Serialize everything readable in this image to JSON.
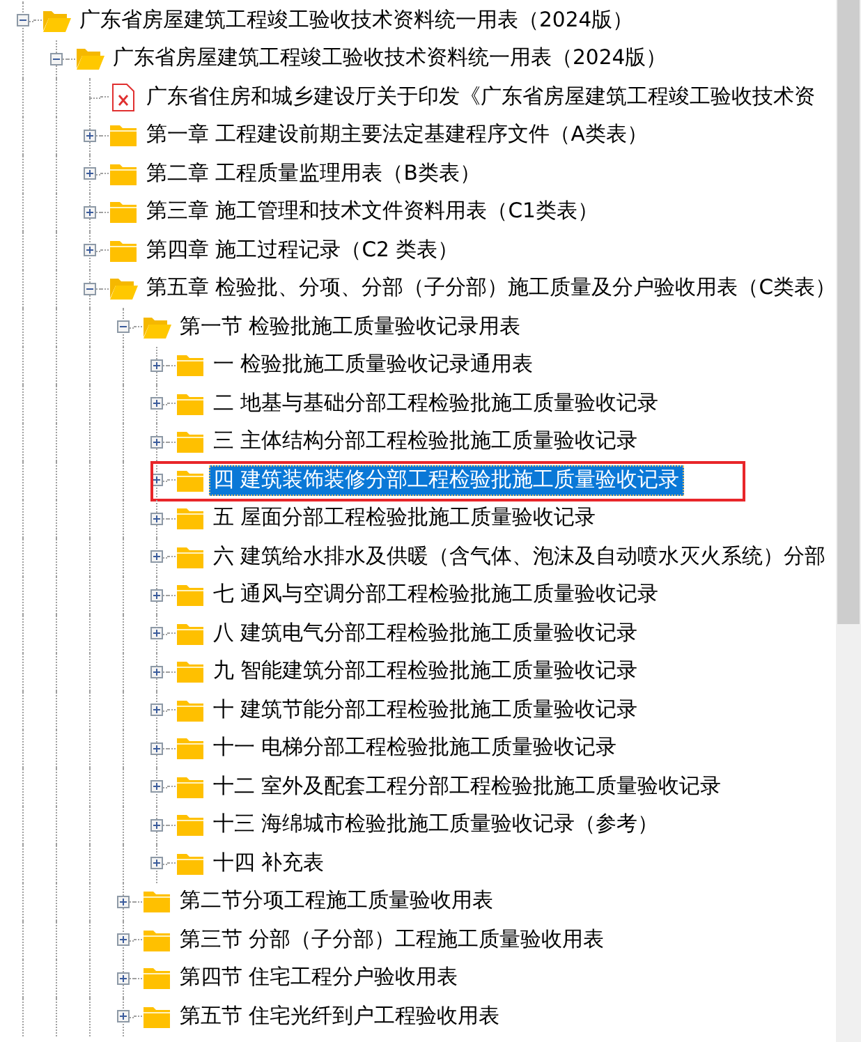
{
  "tree": [
    {
      "label": "广东省房屋建筑工程竣工验收技术资料统一用表（2024版）",
      "kind": "folder",
      "expanded": true,
      "selected": false,
      "children": [
        {
          "label": "广东省房屋建筑工程竣工验收技术资料统一用表（2024版）",
          "kind": "folder",
          "expanded": true,
          "selected": false,
          "children": [
            {
              "label": "广东省住房和城乡建设厅关于印发《广东省房屋建筑工程竣工验收技术资",
              "kind": "file",
              "selected": false
            },
            {
              "label": "第一章 工程建设前期主要法定基建程序文件（A类表）",
              "kind": "folder",
              "expanded": false,
              "selected": false
            },
            {
              "label": "第二章 工程质量监理用表（B类表）",
              "kind": "folder",
              "expanded": false,
              "selected": false
            },
            {
              "label": "第三章 施工管理和技术文件资料用表（C1类表）",
              "kind": "folder",
              "expanded": false,
              "selected": false
            },
            {
              "label": "第四章 施工过程记录（C2 类表）",
              "kind": "folder",
              "expanded": false,
              "selected": false
            },
            {
              "label": "第五章 检验批、分项、分部（子分部）施工质量及分户验收用表（C类表）",
              "kind": "folder",
              "expanded": true,
              "selected": false,
              "children": [
                {
                  "label": "第一节 检验批施工质量验收记录用表",
                  "kind": "folder",
                  "expanded": true,
                  "selected": false,
                  "children": [
                    {
                      "label": "一 检验批施工质量验收记录通用表",
                      "kind": "folder",
                      "expanded": false,
                      "selected": false
                    },
                    {
                      "label": "二 地基与基础分部工程检验批施工质量验收记录",
                      "kind": "folder",
                      "expanded": false,
                      "selected": false
                    },
                    {
                      "label": "三 主体结构分部工程检验批施工质量验收记录",
                      "kind": "folder",
                      "expanded": false,
                      "selected": false
                    },
                    {
                      "label": "四 建筑装饰装修分部工程检验批施工质量验收记录",
                      "kind": "folder",
                      "expanded": false,
                      "selected": true
                    },
                    {
                      "label": "五 屋面分部工程检验批施工质量验收记录",
                      "kind": "folder",
                      "expanded": false,
                      "selected": false
                    },
                    {
                      "label": "六 建筑给水排水及供暖（含气体、泡沫及自动喷水灭火系统）分部",
                      "kind": "folder",
                      "expanded": false,
                      "selected": false
                    },
                    {
                      "label": "七 通风与空调分部工程检验批施工质量验收记录",
                      "kind": "folder",
                      "expanded": false,
                      "selected": false
                    },
                    {
                      "label": "八 建筑电气分部工程检验批施工质量验收记录",
                      "kind": "folder",
                      "expanded": false,
                      "selected": false
                    },
                    {
                      "label": "九 智能建筑分部工程检验批施工质量验收记录",
                      "kind": "folder",
                      "expanded": false,
                      "selected": false
                    },
                    {
                      "label": "十 建筑节能分部工程检验批施工质量验收记录",
                      "kind": "folder",
                      "expanded": false,
                      "selected": false
                    },
                    {
                      "label": "十一 电梯分部工程检验批施工质量验收记录",
                      "kind": "folder",
                      "expanded": false,
                      "selected": false
                    },
                    {
                      "label": "十二 室外及配套工程分部工程检验批施工质量验收记录",
                      "kind": "folder",
                      "expanded": false,
                      "selected": false
                    },
                    {
                      "label": "十三 海绵城市检验批施工质量验收记录（参考）",
                      "kind": "folder",
                      "expanded": false,
                      "selected": false
                    },
                    {
                      "label": "十四 补充表",
                      "kind": "folder",
                      "expanded": false,
                      "selected": false
                    }
                  ]
                },
                {
                  "label": "第二节分项工程施工质量验收用表",
                  "kind": "folder",
                  "expanded": false,
                  "selected": false
                },
                {
                  "label": "第三节 分部（子分部）工程施工质量验收用表",
                  "kind": "folder",
                  "expanded": false,
                  "selected": false
                },
                {
                  "label": "第四节 住宅工程分户验收用表",
                  "kind": "folder",
                  "expanded": false,
                  "selected": false
                },
                {
                  "label": "第五节 住宅光纤到户工程验收用表",
                  "kind": "folder",
                  "expanded": false,
                  "selected": false
                }
              ]
            }
          ]
        }
      ]
    }
  ]
}
